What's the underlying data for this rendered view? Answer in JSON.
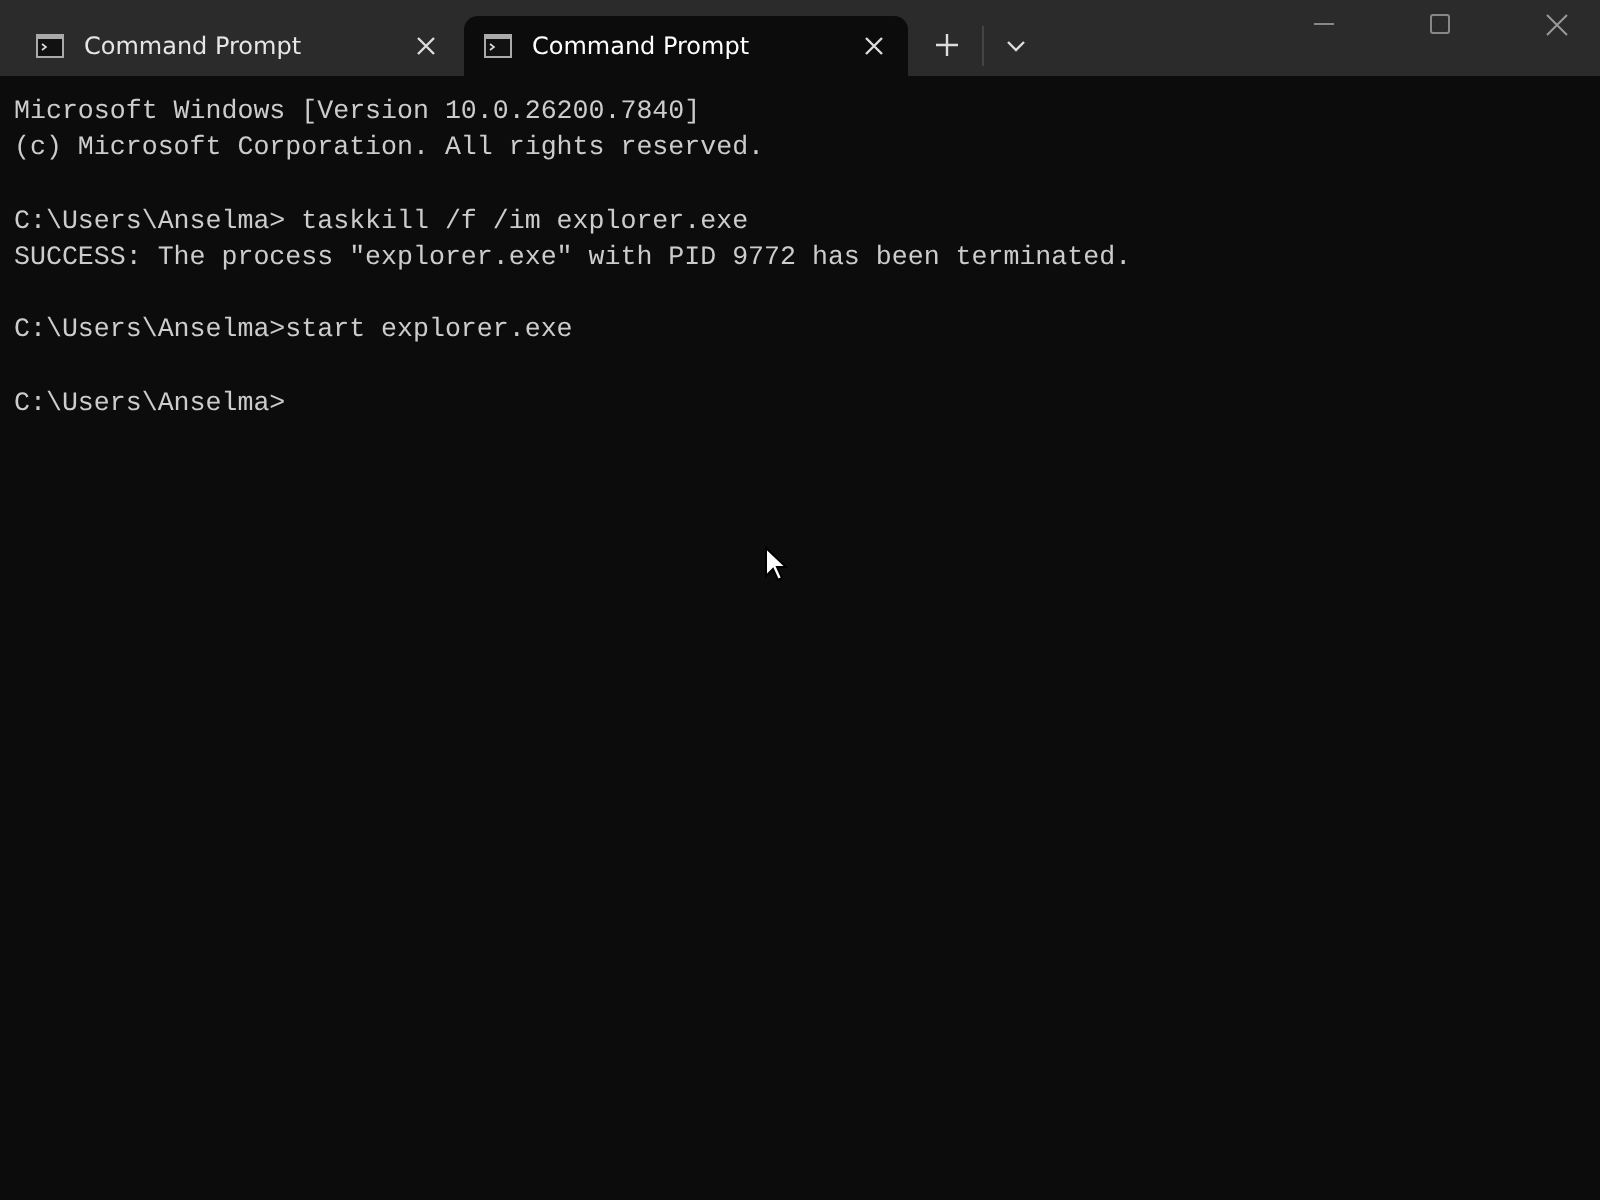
{
  "tabs": [
    {
      "label": "Command Prompt",
      "selected": false
    },
    {
      "label": "Command Prompt",
      "selected": true
    }
  ],
  "terminal": {
    "blocks": [
      [
        "Microsoft Windows [Version 10.0.26200.7840]",
        "(c) Microsoft Corporation. All rights reserved."
      ],
      [
        "C:\\Users\\Anselma> taskkill /f /im explorer.exe",
        "SUCCESS: The process \"explorer.exe\" with PID 9772 has been terminated."
      ],
      [
        "C:\\Users\\Anselma>start explorer.exe"
      ],
      [
        "C:\\Users\\Anselma>"
      ]
    ]
  }
}
